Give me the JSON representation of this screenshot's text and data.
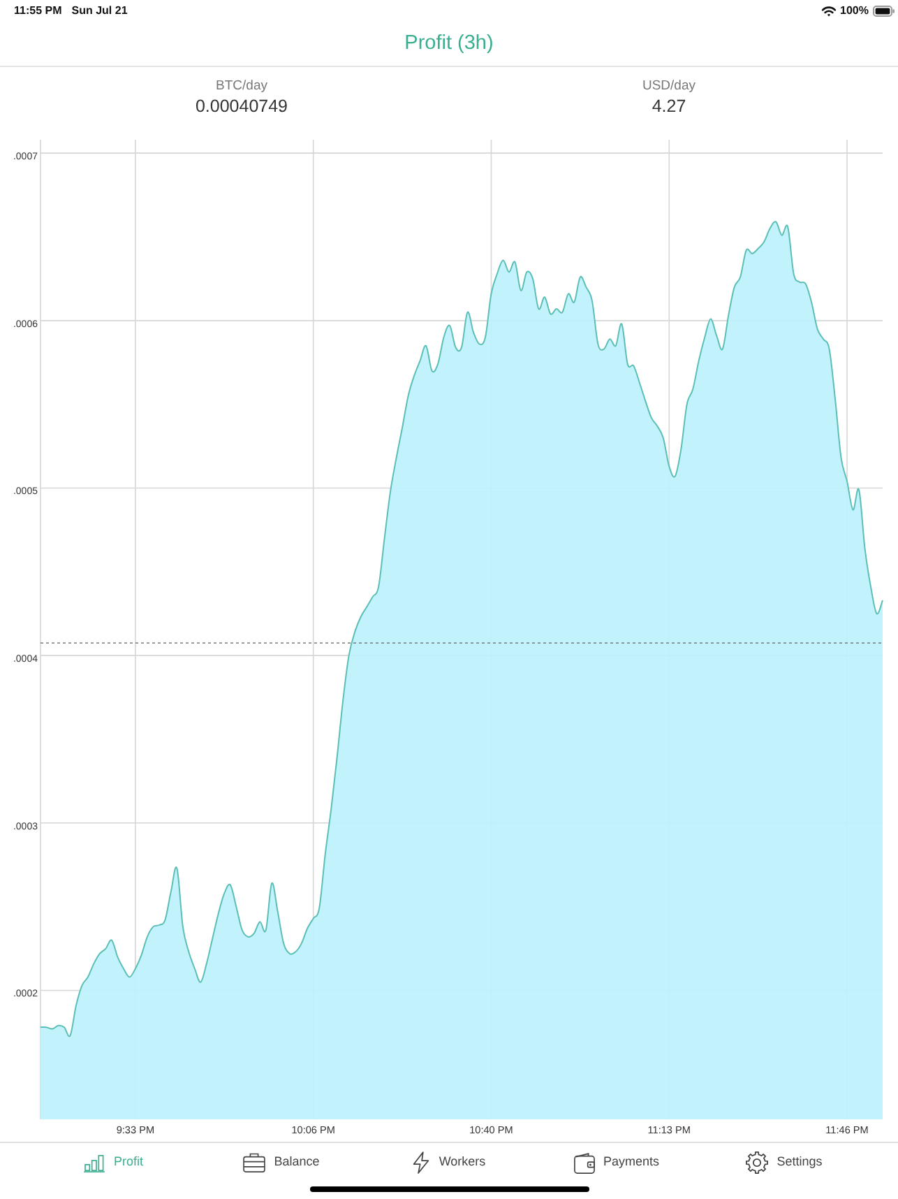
{
  "status_bar": {
    "time": "11:55 PM",
    "date": "Sun Jul 21",
    "battery": "100%"
  },
  "header": {
    "title": "Profit (3h)"
  },
  "stats": [
    {
      "label": "BTC/day",
      "value": "0.00040749"
    },
    {
      "label": "USD/day",
      "value": "4.27"
    }
  ],
  "chart": {
    "chart_data": {
      "type": "area",
      "grid": true,
      "categories": [
        null,
        null,
        null,
        null,
        null,
        null,
        null,
        null,
        null,
        null,
        null,
        null,
        null,
        null,
        null,
        null,
        "9:33 PM",
        null,
        null,
        null,
        null,
        null,
        null,
        null,
        null,
        null,
        null,
        null,
        null,
        null,
        null,
        null,
        null,
        null,
        null,
        null,
        null,
        null,
        null,
        null,
        null,
        null,
        null,
        null,
        null,
        null,
        "10:06 PM",
        null,
        null,
        null,
        null,
        null,
        null,
        null,
        null,
        null,
        null,
        null,
        null,
        null,
        null,
        null,
        null,
        null,
        null,
        null,
        null,
        null,
        null,
        null,
        null,
        null,
        null,
        null,
        null,
        null,
        "10:40 PM",
        null,
        null,
        null,
        null,
        null,
        null,
        null,
        null,
        null,
        null,
        null,
        null,
        null,
        null,
        null,
        null,
        null,
        null,
        null,
        null,
        null,
        null,
        null,
        null,
        null,
        null,
        null,
        null,
        null,
        "11:13 PM",
        null,
        null,
        null,
        null,
        null,
        null,
        null,
        null,
        null,
        null,
        null,
        null,
        null,
        null,
        null,
        null,
        null,
        null,
        null,
        null,
        null,
        null,
        null,
        null,
        null,
        null,
        null,
        null,
        null,
        "11:46 PM",
        null,
        null,
        null,
        null,
        null,
        null
      ],
      "series": [
        {
          "color": "#5bbfb5",
          "values": [
            0.000178,
            0.000178,
            0.000177,
            0.000179,
            0.000178,
            0.000173,
            0.000191,
            0.000203,
            0.000208,
            0.000216,
            0.000222,
            0.000225,
            0.00023,
            0.00022,
            0.000213,
            0.000208,
            0.000213,
            0.000221,
            0.000232,
            0.000238,
            0.000239,
            0.000242,
            0.000259,
            0.000273,
            0.000238,
            0.000223,
            0.000213,
            0.000205,
            0.000216,
            0.000231,
            0.000246,
            0.000258,
            0.000263,
            0.00025,
            0.000236,
            0.000232,
            0.000234,
            0.000241,
            0.000236,
            0.000264,
            0.000247,
            0.000228,
            0.000222,
            0.000223,
            0.000228,
            0.000237,
            0.000243,
            0.000249,
            0.000281,
            0.000308,
            0.000339,
            0.000373,
            0.0004,
            0.000414,
            0.000423,
            0.000429,
            0.000435,
            0.000441,
            0.00047,
            0.000498,
            0.000518,
            0.000536,
            0.000555,
            0.000567,
            0.000576,
            0.000585,
            0.00057,
            0.000574,
            0.00059,
            0.000597,
            0.000584,
            0.000584,
            0.000605,
            0.000593,
            0.000586,
            0.00059,
            0.000616,
            0.000628,
            0.000636,
            0.000629,
            0.000635,
            0.000618,
            0.000629,
            0.000625,
            0.000607,
            0.000614,
            0.000604,
            0.000607,
            0.000605,
            0.000616,
            0.000611,
            0.000626,
            0.00062,
            0.000612,
            0.000586,
            0.000583,
            0.000589,
            0.000585,
            0.000598,
            0.000574,
            0.000573,
            0.000563,
            0.000552,
            0.000542,
            0.000537,
            0.00053,
            0.000513,
            0.000507,
            0.000523,
            0.00055,
            0.000559,
            0.000576,
            0.00059,
            0.000601,
            0.000591,
            0.000583,
            0.000603,
            0.00062,
            0.000626,
            0.000642,
            0.00064,
            0.000643,
            0.000647,
            0.000655,
            0.000659,
            0.000651,
            0.000656,
            0.000628,
            0.000623,
            0.000622,
            0.000611,
            0.000595,
            0.000589,
            0.000583,
            0.000553,
            0.000518,
            0.000504,
            0.000487,
            0.000499,
            0.000464,
            0.000441,
            0.000425,
            0.000433
          ]
        }
      ],
      "ylim": [
        0.000123,
        0.000708
      ],
      "yticks": [
        {
          "value": 0.0002,
          "label": ".0002"
        },
        {
          "value": 0.0003,
          "label": ".0003"
        },
        {
          "value": 0.0004,
          "label": ".0004"
        },
        {
          "value": 0.0005,
          "label": ".0005"
        },
        {
          "value": 0.0006,
          "label": ".0006"
        },
        {
          "value": 0.0007,
          "label": ".0007"
        }
      ],
      "ref_lines": [
        {
          "axis": "y",
          "value": 0.00040749
        }
      ]
    }
  },
  "tabs": [
    {
      "label": "Profit",
      "selected": true
    },
    {
      "label": "Balance",
      "selected": false
    },
    {
      "label": "Workers",
      "selected": false
    },
    {
      "label": "Payments",
      "selected": false
    },
    {
      "label": "Settings",
      "selected": false
    }
  ]
}
